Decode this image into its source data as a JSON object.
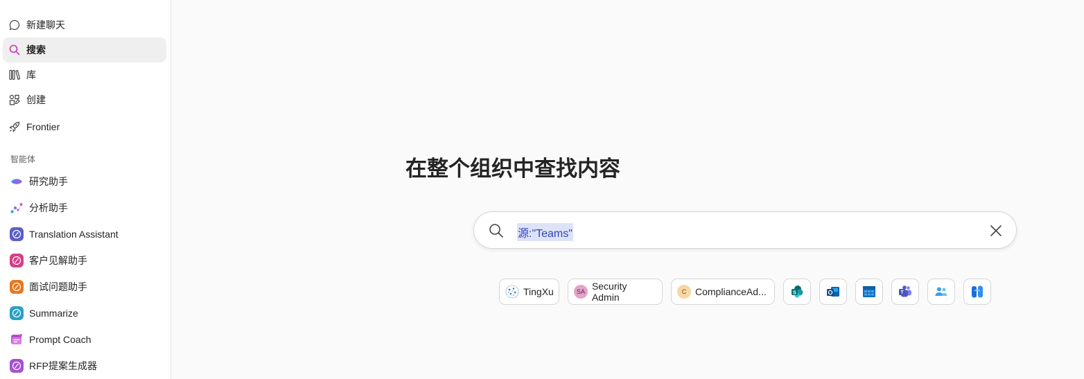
{
  "sidebar": {
    "nav": [
      {
        "label": "新建聊天",
        "icon": "chat-bubble-icon"
      },
      {
        "label": "搜索",
        "icon": "search-icon",
        "active": true
      },
      {
        "label": "库",
        "icon": "library-icon"
      },
      {
        "label": "创建",
        "icon": "create-icon"
      },
      {
        "label": "Frontier",
        "icon": "rocket-icon"
      }
    ],
    "section_label": "智能体",
    "agents": [
      {
        "label": "研究助手",
        "icon": "researcher-icon"
      },
      {
        "label": "分析助手",
        "icon": "analyst-icon"
      },
      {
        "label": "Translation Assistant",
        "icon": "agent-icon",
        "color": "#5b5fc7"
      },
      {
        "label": "客户见解助手",
        "icon": "agent-icon",
        "color": "#d43f87"
      },
      {
        "label": "面试问题助手",
        "icon": "agent-icon",
        "color": "#e8771e"
      },
      {
        "label": "Summarize",
        "icon": "agent-icon",
        "color": "#2a9fc4"
      },
      {
        "label": "Prompt Coach",
        "icon": "prompt-coach-icon",
        "color": "#b24cd9"
      },
      {
        "label": "RFP提案生成器",
        "icon": "agent-icon",
        "color": "#a650d1"
      }
    ]
  },
  "main": {
    "headline": "在整个组织中查找内容",
    "search": {
      "value": "源:\"Teams\"",
      "placeholder": ""
    },
    "people_chips": [
      {
        "label": "TingXu",
        "avatar": "tx-avatar",
        "avatar_text": ""
      },
      {
        "label": "Security Admin",
        "avatar_text": "SA",
        "avatar_color": "#e3a3c8"
      },
      {
        "label": "ComplianceAd...",
        "avatar_text": "C",
        "avatar_color": "#f7d7a6"
      }
    ],
    "app_chips": [
      {
        "name": "sharepoint-icon"
      },
      {
        "name": "outlook-icon"
      },
      {
        "name": "planner-icon"
      },
      {
        "name": "teams-icon"
      },
      {
        "name": "people-icon"
      },
      {
        "name": "loop-icon"
      }
    ]
  },
  "colors": {
    "accent": "#5b5fc7",
    "highlight": "#dde3f7",
    "active_bg": "#efefef"
  }
}
